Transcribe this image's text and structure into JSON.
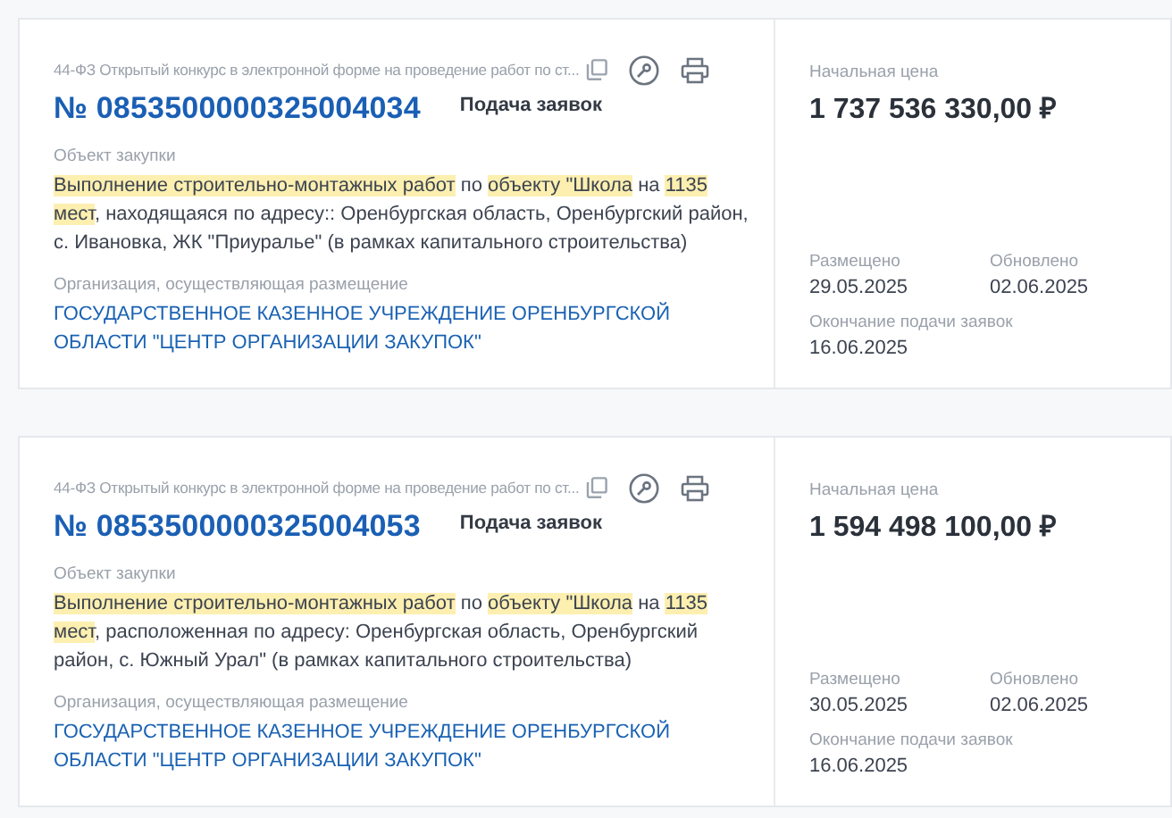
{
  "cards": [
    {
      "procedure": "44-ФЗ Открытый конкурс в электронной форме на проведение работ по ст...",
      "number": "№ 0853500000325004034",
      "status": "Подача заявок",
      "object_label": "Объект закупки",
      "object_text": [
        {
          "text": "Выполнение строительно-монтажных работ",
          "highlighted": true
        },
        {
          "text": " по ",
          "highlighted": false
        },
        {
          "text": "объекту \"Школа",
          "highlighted": true
        },
        {
          "text": " на ",
          "highlighted": false
        },
        {
          "text": "1135 мест",
          "highlighted": true
        },
        {
          "text": ", находящаяся по адресу:: Оренбургская область, Оренбургский район, с. Ивановка, ЖК \"Приуралье\" (в рамках капитального строительства)",
          "highlighted": false
        }
      ],
      "org_label": "Организация, осуществляющая размещение",
      "org": "ГОСУДАРСТВЕННОЕ КАЗЕННОЕ УЧРЕЖДЕНИЕ ОРЕНБУРГСКОЙ ОБЛАСТИ \"ЦЕНТР ОРГАНИЗАЦИИ ЗАКУПОК\"",
      "price_label": "Начальная цена",
      "price": "1 737 536 330,00 ₽",
      "posted_label": "Размещено",
      "posted": "29.05.2025",
      "updated_label": "Обновлено",
      "updated": "02.06.2025",
      "deadline_label": "Окончание подачи заявок",
      "deadline": "16.06.2025"
    },
    {
      "procedure": "44-ФЗ Открытый конкурс в электронной форме на проведение работ по ст...",
      "number": "№ 0853500000325004053",
      "status": "Подача заявок",
      "object_label": "Объект закупки",
      "object_text": [
        {
          "text": "Выполнение строительно-монтажных работ",
          "highlighted": true
        },
        {
          "text": " по ",
          "highlighted": false
        },
        {
          "text": "объекту \"Школа",
          "highlighted": true
        },
        {
          "text": " на ",
          "highlighted": false
        },
        {
          "text": "1135 мест",
          "highlighted": true
        },
        {
          "text": ", расположенная по адресу: Оренбургская область, Оренбургский район, с. Южный Урал\" (в рамках капитального строительства)",
          "highlighted": false
        }
      ],
      "org_label": "Организация, осуществляющая размещение",
      "org": "ГОСУДАРСТВЕННОЕ КАЗЕННОЕ УЧРЕЖДЕНИЕ ОРЕНБУРГСКОЙ ОБЛАСТИ \"ЦЕНТР ОРГАНИЗАЦИИ ЗАКУПОК\"",
      "price_label": "Начальная цена",
      "price": "1 594 498 100,00 ₽",
      "posted_label": "Размещено",
      "posted": "30.05.2025",
      "updated_label": "Обновлено",
      "updated": "02.06.2025",
      "deadline_label": "Окончание подачи заявок",
      "deadline": "16.06.2025"
    }
  ]
}
